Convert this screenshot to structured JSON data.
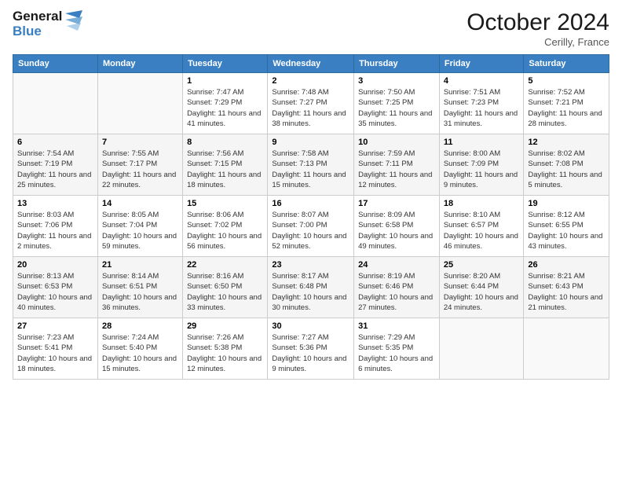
{
  "header": {
    "logo_line1": "General",
    "logo_line2": "Blue",
    "month": "October 2024",
    "location": "Cerilly, France"
  },
  "days_header": [
    "Sunday",
    "Monday",
    "Tuesday",
    "Wednesday",
    "Thursday",
    "Friday",
    "Saturday"
  ],
  "weeks": [
    [
      {
        "num": "",
        "detail": ""
      },
      {
        "num": "",
        "detail": ""
      },
      {
        "num": "1",
        "detail": "Sunrise: 7:47 AM\nSunset: 7:29 PM\nDaylight: 11 hours and 41 minutes."
      },
      {
        "num": "2",
        "detail": "Sunrise: 7:48 AM\nSunset: 7:27 PM\nDaylight: 11 hours and 38 minutes."
      },
      {
        "num": "3",
        "detail": "Sunrise: 7:50 AM\nSunset: 7:25 PM\nDaylight: 11 hours and 35 minutes."
      },
      {
        "num": "4",
        "detail": "Sunrise: 7:51 AM\nSunset: 7:23 PM\nDaylight: 11 hours and 31 minutes."
      },
      {
        "num": "5",
        "detail": "Sunrise: 7:52 AM\nSunset: 7:21 PM\nDaylight: 11 hours and 28 minutes."
      }
    ],
    [
      {
        "num": "6",
        "detail": "Sunrise: 7:54 AM\nSunset: 7:19 PM\nDaylight: 11 hours and 25 minutes."
      },
      {
        "num": "7",
        "detail": "Sunrise: 7:55 AM\nSunset: 7:17 PM\nDaylight: 11 hours and 22 minutes."
      },
      {
        "num": "8",
        "detail": "Sunrise: 7:56 AM\nSunset: 7:15 PM\nDaylight: 11 hours and 18 minutes."
      },
      {
        "num": "9",
        "detail": "Sunrise: 7:58 AM\nSunset: 7:13 PM\nDaylight: 11 hours and 15 minutes."
      },
      {
        "num": "10",
        "detail": "Sunrise: 7:59 AM\nSunset: 7:11 PM\nDaylight: 11 hours and 12 minutes."
      },
      {
        "num": "11",
        "detail": "Sunrise: 8:00 AM\nSunset: 7:09 PM\nDaylight: 11 hours and 9 minutes."
      },
      {
        "num": "12",
        "detail": "Sunrise: 8:02 AM\nSunset: 7:08 PM\nDaylight: 11 hours and 5 minutes."
      }
    ],
    [
      {
        "num": "13",
        "detail": "Sunrise: 8:03 AM\nSunset: 7:06 PM\nDaylight: 11 hours and 2 minutes."
      },
      {
        "num": "14",
        "detail": "Sunrise: 8:05 AM\nSunset: 7:04 PM\nDaylight: 10 hours and 59 minutes."
      },
      {
        "num": "15",
        "detail": "Sunrise: 8:06 AM\nSunset: 7:02 PM\nDaylight: 10 hours and 56 minutes."
      },
      {
        "num": "16",
        "detail": "Sunrise: 8:07 AM\nSunset: 7:00 PM\nDaylight: 10 hours and 52 minutes."
      },
      {
        "num": "17",
        "detail": "Sunrise: 8:09 AM\nSunset: 6:58 PM\nDaylight: 10 hours and 49 minutes."
      },
      {
        "num": "18",
        "detail": "Sunrise: 8:10 AM\nSunset: 6:57 PM\nDaylight: 10 hours and 46 minutes."
      },
      {
        "num": "19",
        "detail": "Sunrise: 8:12 AM\nSunset: 6:55 PM\nDaylight: 10 hours and 43 minutes."
      }
    ],
    [
      {
        "num": "20",
        "detail": "Sunrise: 8:13 AM\nSunset: 6:53 PM\nDaylight: 10 hours and 40 minutes."
      },
      {
        "num": "21",
        "detail": "Sunrise: 8:14 AM\nSunset: 6:51 PM\nDaylight: 10 hours and 36 minutes."
      },
      {
        "num": "22",
        "detail": "Sunrise: 8:16 AM\nSunset: 6:50 PM\nDaylight: 10 hours and 33 minutes."
      },
      {
        "num": "23",
        "detail": "Sunrise: 8:17 AM\nSunset: 6:48 PM\nDaylight: 10 hours and 30 minutes."
      },
      {
        "num": "24",
        "detail": "Sunrise: 8:19 AM\nSunset: 6:46 PM\nDaylight: 10 hours and 27 minutes."
      },
      {
        "num": "25",
        "detail": "Sunrise: 8:20 AM\nSunset: 6:44 PM\nDaylight: 10 hours and 24 minutes."
      },
      {
        "num": "26",
        "detail": "Sunrise: 8:21 AM\nSunset: 6:43 PM\nDaylight: 10 hours and 21 minutes."
      }
    ],
    [
      {
        "num": "27",
        "detail": "Sunrise: 7:23 AM\nSunset: 5:41 PM\nDaylight: 10 hours and 18 minutes."
      },
      {
        "num": "28",
        "detail": "Sunrise: 7:24 AM\nSunset: 5:40 PM\nDaylight: 10 hours and 15 minutes."
      },
      {
        "num": "29",
        "detail": "Sunrise: 7:26 AM\nSunset: 5:38 PM\nDaylight: 10 hours and 12 minutes."
      },
      {
        "num": "30",
        "detail": "Sunrise: 7:27 AM\nSunset: 5:36 PM\nDaylight: 10 hours and 9 minutes."
      },
      {
        "num": "31",
        "detail": "Sunrise: 7:29 AM\nSunset: 5:35 PM\nDaylight: 10 hours and 6 minutes."
      },
      {
        "num": "",
        "detail": ""
      },
      {
        "num": "",
        "detail": ""
      }
    ]
  ]
}
